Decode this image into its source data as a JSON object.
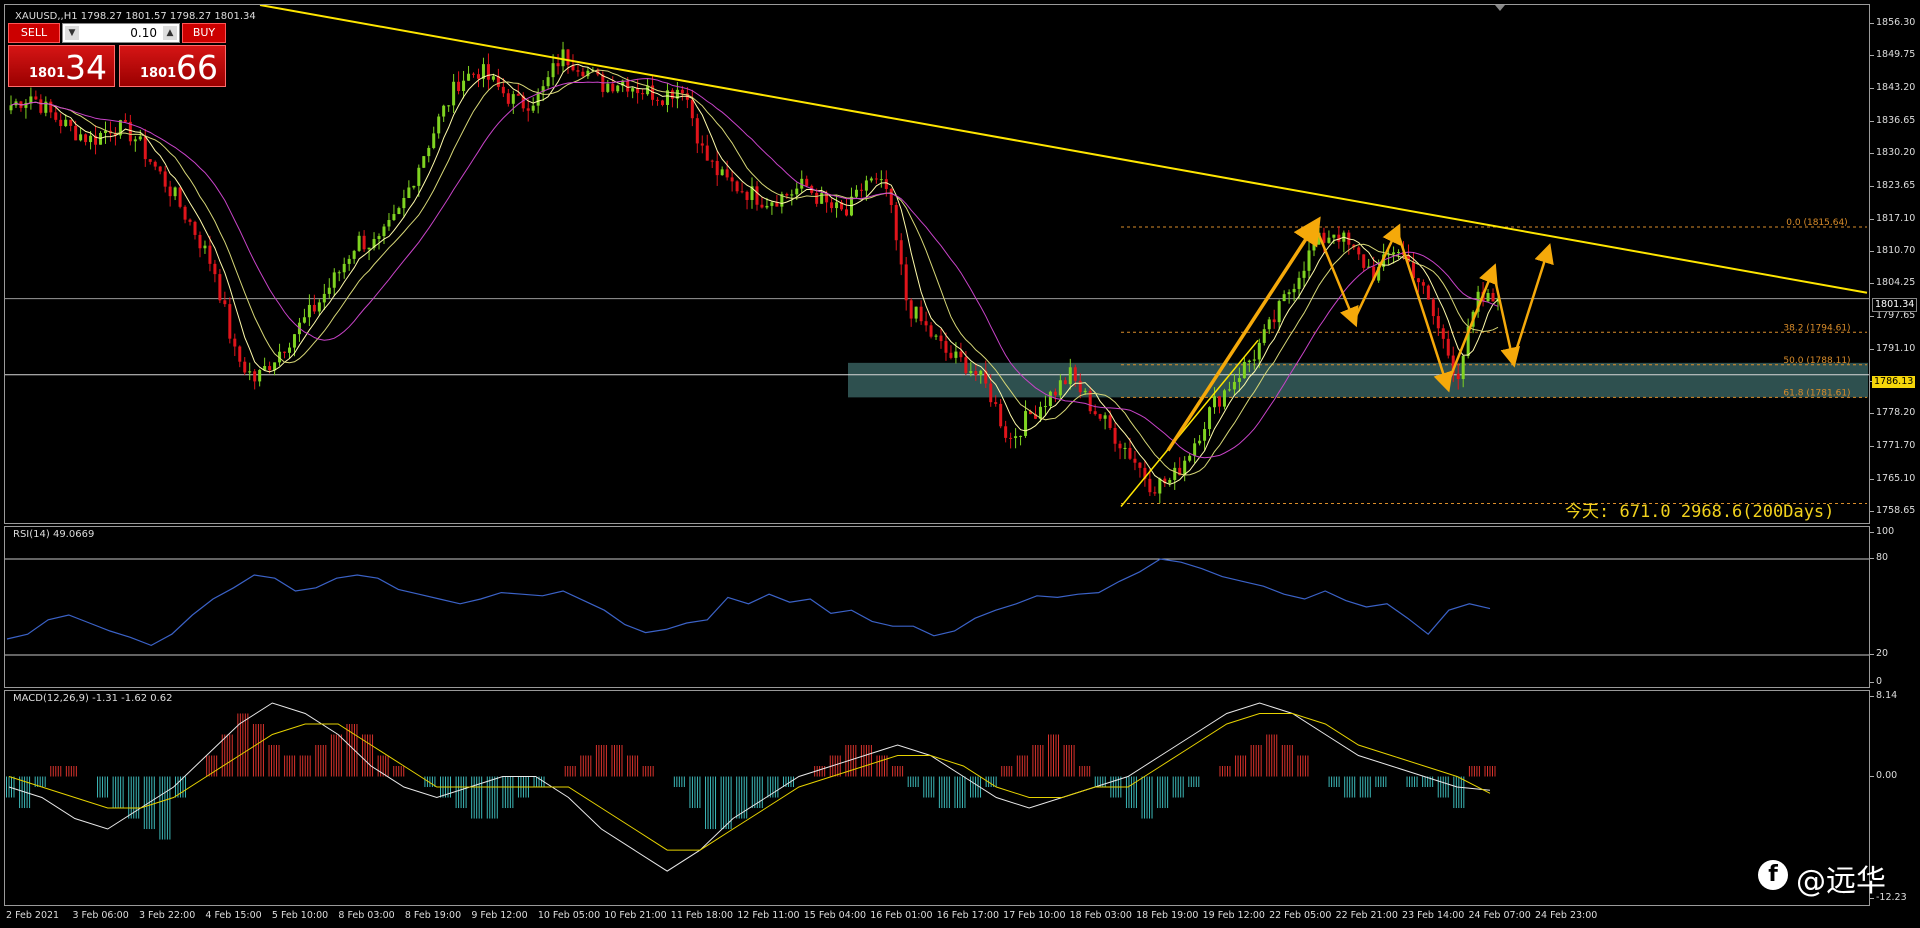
{
  "title": "XAUUSD,,H1  1798.27 1801.57 1798.27 1801.34",
  "trade_panel": {
    "sell_label": "SELL",
    "buy_label": "BUY",
    "lot": "0.10",
    "bid_small": "1801",
    "bid_big": "34",
    "ask_small": "1801",
    "ask_big": "66"
  },
  "annotation_today": "今天:  671.0  2968.6(200Days)",
  "watermark": "@远华",
  "colors": {
    "bull": "#7fd321",
    "bear": "#e0141b",
    "trend": "#ffe600",
    "arrow": "#f5a90a",
    "fib": "#d98c2a",
    "ma_fast": "#fffbaa",
    "ma_slow": "#c843c8",
    "rsi": "#3b62c7",
    "zone": "#3e6b6a"
  },
  "chart_data": [
    {
      "type": "candlestick",
      "symbol": "XAUUSD",
      "timeframe": "H1",
      "ohlc_current": {
        "open": 1798.27,
        "high": 1801.57,
        "low": 1798.27,
        "close": 1801.34
      },
      "current_price": "1801.34",
      "marked_price": "1786.13",
      "y_ticks": [
        "1856.30",
        "1849.75",
        "1843.20",
        "1836.65",
        "1830.20",
        "1823.65",
        "1817.10",
        "1810.70",
        "1804.25",
        "1797.65",
        "1791.10",
        "1784.75",
        "1778.20",
        "1771.70",
        "1765.10",
        "1758.65"
      ],
      "ylim": [
        1756.5,
        1860
      ],
      "x_ticks": [
        "2 Feb 2021",
        "3 Feb 06:00",
        "3 Feb 22:00",
        "4 Feb 15:00",
        "5 Feb 10:00",
        "8 Feb 03:00",
        "8 Feb 19:00",
        "9 Feb 12:00",
        "10 Feb 05:00",
        "10 Feb 21:00",
        "11 Feb 18:00",
        "12 Feb 11:00",
        "15 Feb 04:00",
        "16 Feb 01:00",
        "16 Feb 17:00",
        "17 Feb 10:00",
        "18 Feb 03:00",
        "18 Feb 19:00",
        "19 Feb 12:00",
        "22 Feb 05:00",
        "22 Feb 21:00",
        "23 Feb 14:00",
        "24 Feb 07:00",
        "24 Feb 23:00"
      ],
      "close_path": [
        1840,
        1842,
        1838,
        1835,
        1833,
        1836,
        1834,
        1828,
        1822,
        1815,
        1807,
        1790,
        1785,
        1790,
        1795,
        1800,
        1806,
        1813,
        1812,
        1818,
        1828,
        1837,
        1845,
        1847,
        1843,
        1840,
        1842,
        1850,
        1848,
        1844,
        1845,
        1843,
        1842,
        1844,
        1830,
        1825,
        1823,
        1821,
        1822,
        1824,
        1820,
        1818,
        1825,
        1823,
        1800,
        1795,
        1790,
        1788,
        1783,
        1773,
        1778,
        1782,
        1786,
        1780,
        1775,
        1770,
        1764,
        1765,
        1772,
        1780,
        1785,
        1790,
        1797,
        1805,
        1812,
        1815,
        1810,
        1806,
        1812,
        1806,
        1796,
        1786,
        1801,
        1801
      ],
      "fibonacci": [
        {
          "level": "0.0",
          "price": 1815.64,
          "label": "0.0 (1815.64)"
        },
        {
          "level": "38.2",
          "price": 1794.61,
          "label": "38.2 (1794.61)"
        },
        {
          "level": "50.0",
          "price": 1788.11,
          "label": "50.0 (1788.11)"
        },
        {
          "level": "61.8",
          "price": 1781.61,
          "label": "61.8 (1781.61)"
        },
        {
          "level": "100.0",
          "price": 1760.4
        }
      ]
    },
    {
      "type": "line",
      "name": "RSI(14) 49.0669",
      "levels": [
        "100",
        "80",
        "20",
        "0"
      ],
      "ylim": [
        0,
        100
      ],
      "values": [
        30,
        33,
        42,
        45,
        40,
        35,
        31,
        26,
        33,
        45,
        55,
        62,
        70,
        68,
        60,
        62,
        68,
        70,
        68,
        61,
        58,
        55,
        52,
        55,
        59,
        58,
        57,
        60,
        54,
        48,
        39,
        34,
        36,
        40,
        42,
        56,
        52,
        58,
        53,
        55,
        46,
        48,
        41,
        38,
        38,
        32,
        35,
        43,
        48,
        52,
        57,
        56,
        58,
        59,
        66,
        72,
        80,
        78,
        74,
        69,
        66,
        63,
        58,
        55,
        60,
        54,
        50,
        52,
        43,
        33,
        48,
        52,
        49
      ]
    },
    {
      "type": "bar+line",
      "name": "MACD(12,26,9) -1.31 -1.62 0.62",
      "y_ticks": [
        "8.14",
        "0.00",
        "-12.23"
      ],
      "ylim": [
        -12.23,
        8.14
      ],
      "histogram": [
        -2,
        -3,
        -1,
        1,
        1,
        0,
        -2,
        -3,
        -4,
        -5,
        -6,
        -2,
        0,
        2,
        4,
        6,
        5,
        3,
        2,
        2,
        3,
        4,
        5,
        4,
        2,
        1,
        0,
        -1,
        -2,
        -3,
        -4,
        -4,
        -3,
        -2,
        -1,
        0,
        1,
        2,
        3,
        3,
        2,
        1,
        0,
        -1,
        -3,
        -5,
        -5,
        -4,
        -3,
        -2,
        -1,
        0,
        1,
        2,
        3,
        3,
        2,
        1,
        -1,
        -2,
        -3,
        -3,
        -2,
        -1,
        1,
        2,
        3,
        4,
        3,
        1,
        -1,
        -2,
        -3,
        -4,
        -3,
        -2,
        -1,
        0,
        1,
        2,
        3,
        4,
        3,
        2,
        0,
        -1,
        -2,
        -2,
        -1,
        0,
        -1,
        -1,
        -2,
        -3,
        1,
        1
      ],
      "macd": [
        -1,
        -2,
        -4,
        -5,
        -3,
        -1,
        2,
        5,
        7,
        6,
        4,
        1,
        -1,
        -2,
        -1,
        0,
        0,
        -2,
        -5,
        -7,
        -9,
        -7,
        -4,
        -2,
        0,
        1,
        2,
        3,
        2,
        0,
        -2,
        -3,
        -2,
        -1,
        0,
        2,
        4,
        6,
        7,
        6,
        4,
        2,
        1,
        0,
        -1,
        -1.3
      ],
      "signal": [
        0,
        -1,
        -2,
        -3,
        -3,
        -2,
        0,
        2,
        4,
        5,
        5,
        3,
        1,
        -1,
        -1,
        -1,
        -1,
        -1,
        -3,
        -5,
        -7,
        -7,
        -5,
        -3,
        -1,
        0,
        1,
        2,
        2,
        1,
        -1,
        -2,
        -2,
        -1,
        -1,
        1,
        3,
        5,
        6,
        6,
        5,
        3,
        2,
        1,
        0,
        -1.6
      ]
    }
  ]
}
